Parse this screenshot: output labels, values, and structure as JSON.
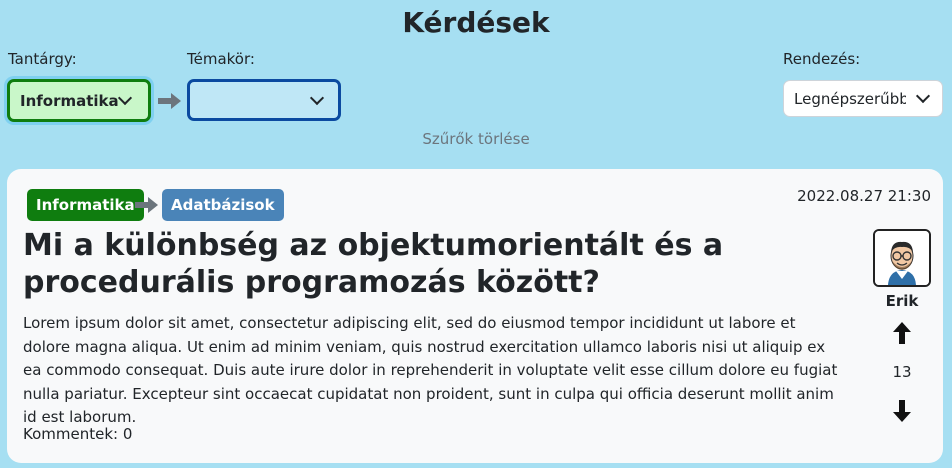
{
  "page": {
    "title": "Kérdések"
  },
  "filters": {
    "subject_label": "Tantárgy:",
    "subject_value": "Informatika",
    "topic_label": "Témakör:",
    "topic_value": "",
    "sort_label": "Rendezés:",
    "sort_value": "Legnépszerűbb",
    "clear_label": "Szűrők törlése"
  },
  "question": {
    "subject": "Informatika",
    "topic": "Adatbázisok",
    "date": "2022.08.27 21:30",
    "title": "Mi a különbség az objektumorientált és a procedurális programozás között?",
    "body": "Lorem ipsum dolor sit amet, consectetur adipiscing elit, sed do eiusmod tempor incididunt ut labore et dolore magna aliqua. Ut enim ad minim veniam, quis nostrud exercitation ullamco laboris nisi ut aliquip ex ea commodo consequat. Duis aute irure dolor in reprehenderit in voluptate velit esse cillum dolore eu fugiat nulla pariatur. Excepteur sint occaecat cupidatat non proident, sunt in culpa qui officia deserunt mollit anim id est laborum.",
    "comments": "Kommentek: 0",
    "author": "Erik",
    "score": "13"
  },
  "colors": {
    "background": "#a6dff2",
    "subject_badge": "#0f7d0f",
    "topic_badge": "#4a84b8"
  }
}
